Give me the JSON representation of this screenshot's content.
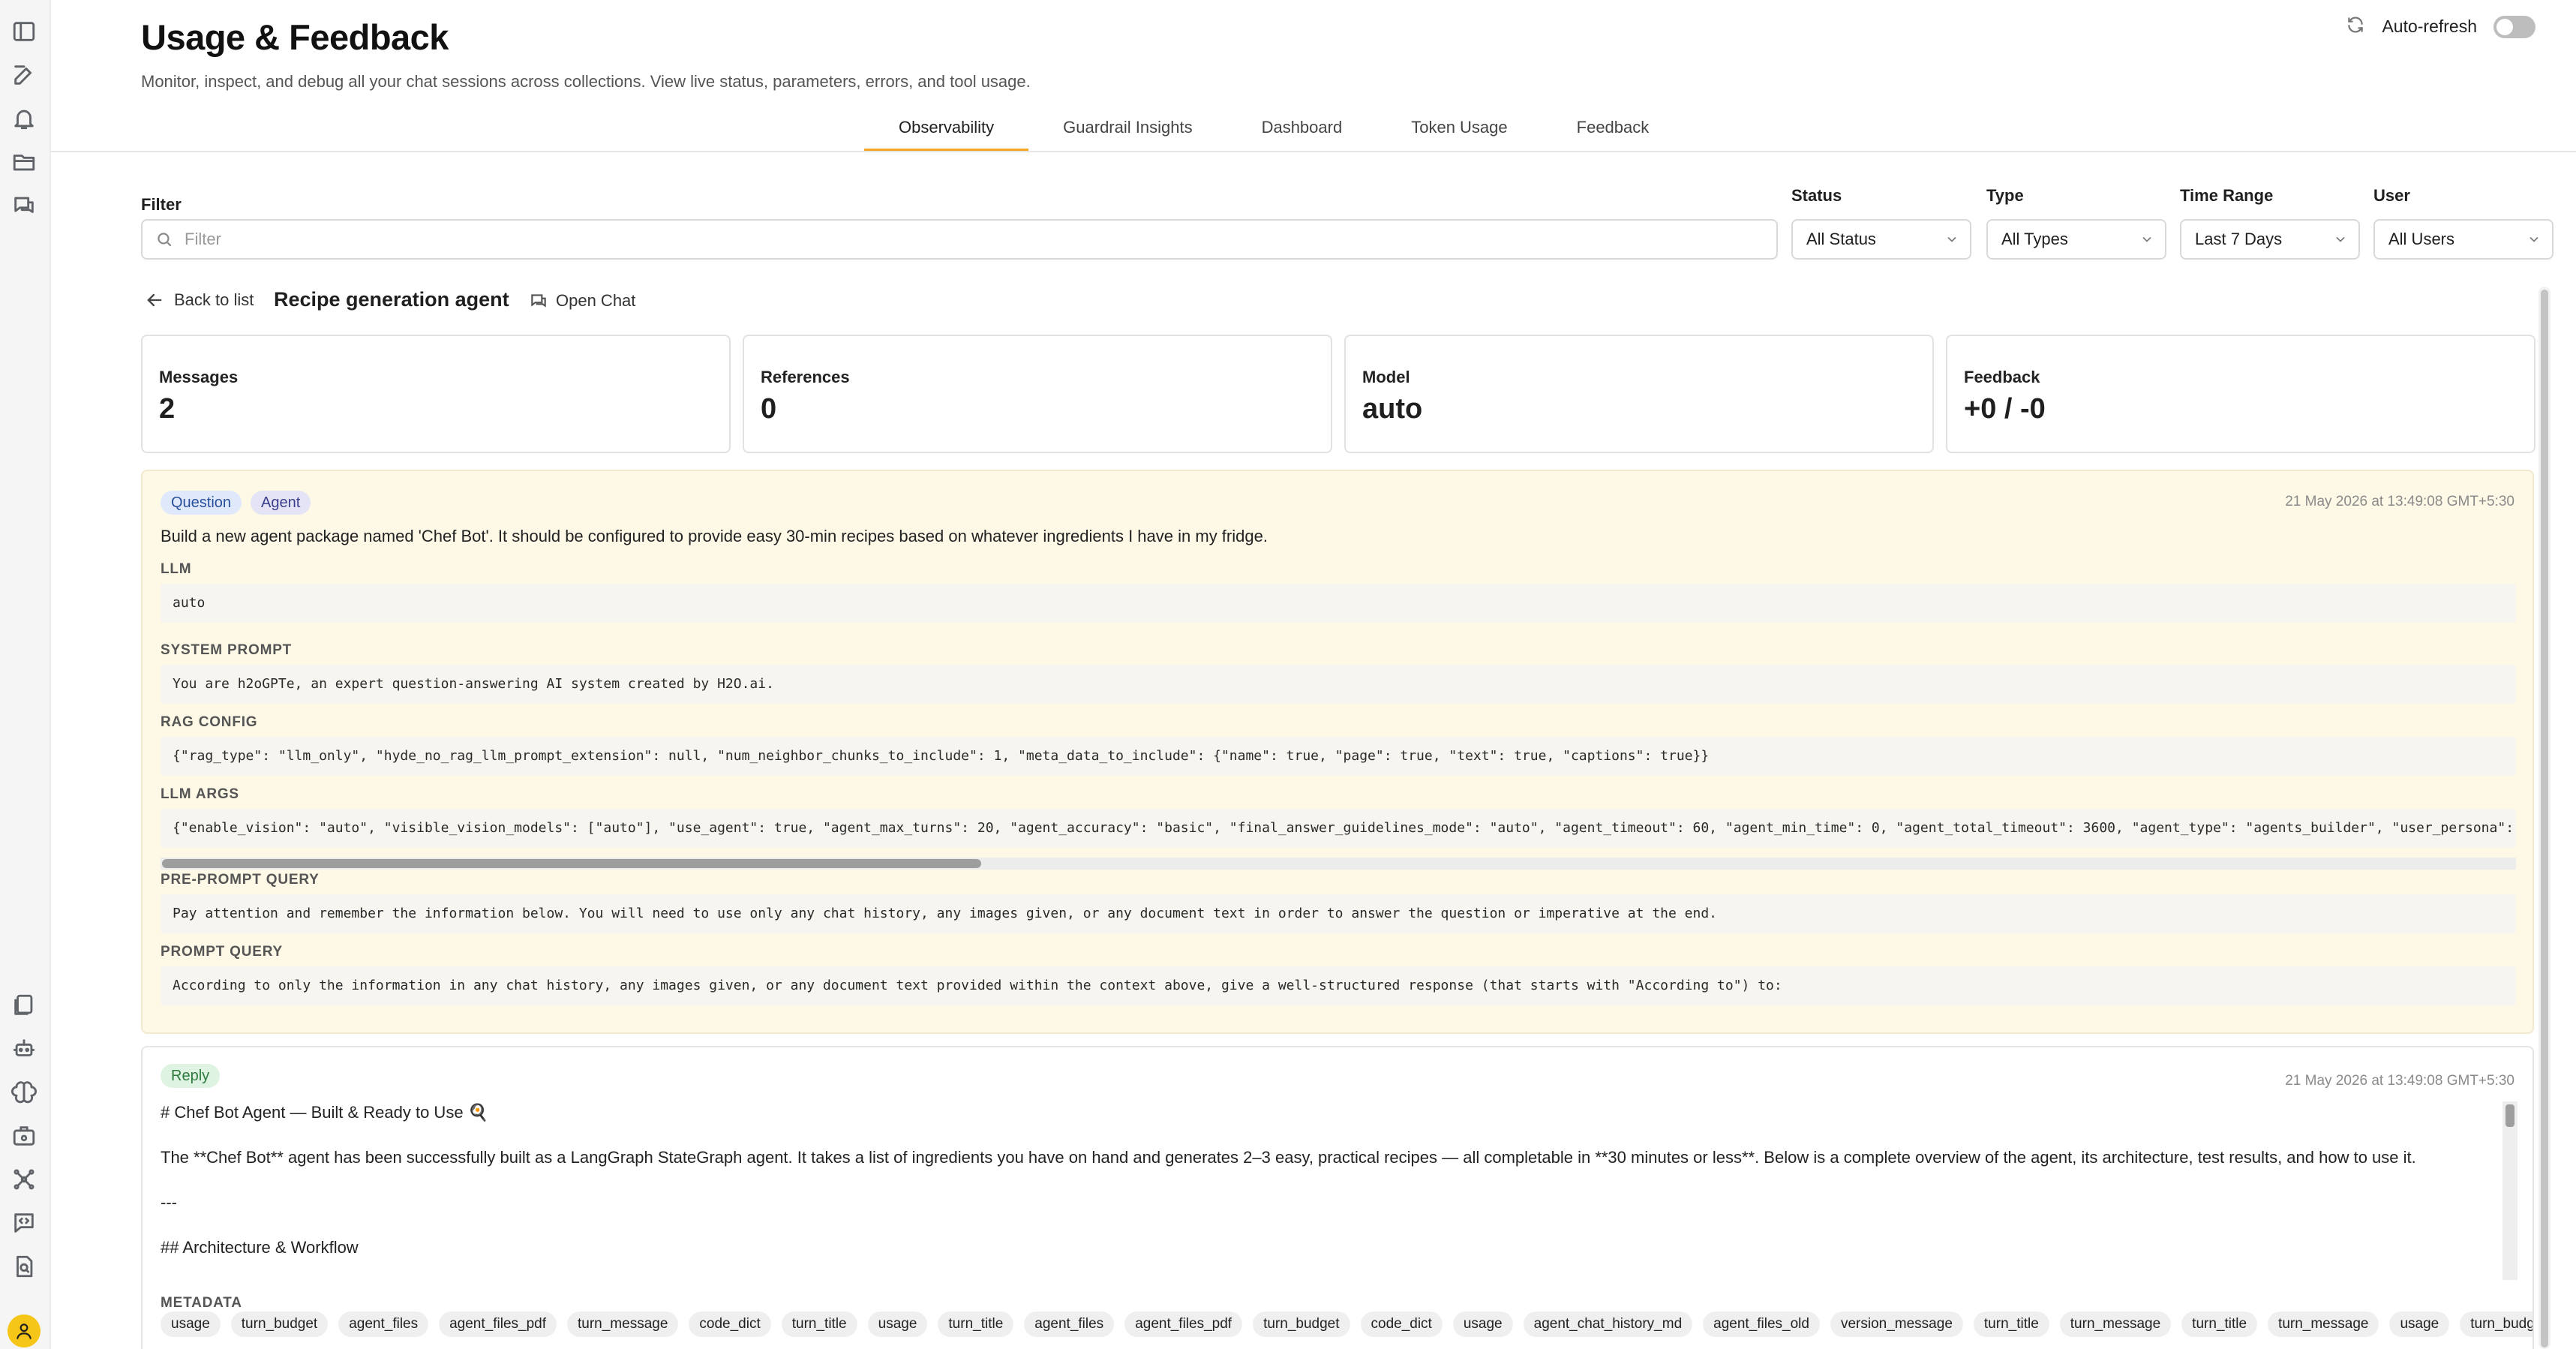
{
  "page": {
    "title": "Usage & Feedback",
    "subtitle": "Monitor, inspect, and debug all your chat sessions across collections. View live status, parameters, errors, and tool usage."
  },
  "autorefresh": {
    "label": "Auto-refresh",
    "enabled": false
  },
  "tabs": [
    {
      "label": "Observability",
      "active": true
    },
    {
      "label": "Guardrail Insights",
      "active": false
    },
    {
      "label": "Dashboard",
      "active": false
    },
    {
      "label": "Token Usage",
      "active": false
    },
    {
      "label": "Feedback",
      "active": false
    }
  ],
  "filters": {
    "filter_label": "Filter",
    "filter_placeholder": "Filter",
    "status": {
      "label": "Status",
      "value": "All Status"
    },
    "type": {
      "label": "Type",
      "value": "All Types"
    },
    "time_range": {
      "label": "Time Range",
      "value": "Last 7 Days"
    },
    "user": {
      "label": "User",
      "value": "All Users"
    }
  },
  "detail": {
    "back_label": "Back to list",
    "agent_name": "Recipe generation agent",
    "open_chat_label": "Open Chat"
  },
  "stats": [
    {
      "label": "Messages",
      "value": "2"
    },
    {
      "label": "References",
      "value": "0"
    },
    {
      "label": "Model",
      "value": "auto"
    },
    {
      "label": "Feedback",
      "value": "+0 / -0"
    }
  ],
  "question": {
    "badges": [
      "Question",
      "Agent"
    ],
    "timestamp": "21 May 2026 at 13:49:08 GMT+5:30",
    "text": "Build a new agent package named 'Chef Bot'. It should be configured to provide easy 30-min recipes based on whatever ingredients I have in my fridge.",
    "sections": {
      "llm": {
        "label": "LLM",
        "value": "auto"
      },
      "system_prompt": {
        "label": "SYSTEM PROMPT",
        "value": "You are h2oGPTe, an expert question-answering AI system created by H2O.ai."
      },
      "rag_config": {
        "label": "RAG CONFIG",
        "value": "{\"rag_type\": \"llm_only\", \"hyde_no_rag_llm_prompt_extension\": null, \"num_neighbor_chunks_to_include\": 1, \"meta_data_to_include\": {\"name\": true, \"page\": true, \"text\": true, \"captions\": true}}"
      },
      "llm_args": {
        "label": "LLM ARGS",
        "value": "{\"enable_vision\": \"auto\", \"visible_vision_models\": [\"auto\"], \"use_agent\": true, \"agent_max_turns\": 20, \"agent_accuracy\": \"basic\", \"final_answer_guidelines_mode\": \"auto\", \"agent_timeout\": 60, \"agent_min_time\": 0, \"agent_total_timeout\": 3600, \"agent_type\": \"agents_builder\", \"user_persona\":"
      },
      "pre_prompt_query": {
        "label": "PRE-PROMPT QUERY",
        "value": "Pay attention and remember the information below. You will need to use only any chat history, any images given, or any document text in order to answer the question or imperative at the end."
      },
      "prompt_query": {
        "label": "PROMPT QUERY",
        "value": "According to only the information in any chat history, any images given, or any document text provided within the context above, give a well-structured response (that starts with \"According to\") to:"
      }
    }
  },
  "reply": {
    "badge": "Reply",
    "timestamp": "21 May 2026 at 13:49:08 GMT+5:30",
    "lines": [
      "# Chef Bot Agent — Built & Ready to Use 🍳",
      "The **Chef Bot** agent has been successfully built as a LangGraph StateGraph agent. It takes a list of ingredients you have on hand and generates 2–3 easy, practical recipes — all completable in **30 minutes or less**. Below is a complete overview of the agent, its architecture, test results, and how to use it.",
      "---",
      "## Architecture & Workflow"
    ],
    "metadata_label": "METADATA",
    "metadata": [
      "usage",
      "turn_budget",
      "agent_files",
      "agent_files_pdf",
      "turn_message",
      "code_dict",
      "turn_title",
      "usage",
      "turn_title",
      "agent_files",
      "agent_files_pdf",
      "turn_budget",
      "code_dict",
      "usage",
      "agent_chat_history_md",
      "agent_files_old",
      "version_message",
      "turn_title",
      "turn_message",
      "turn_title",
      "turn_message",
      "usage",
      "turn_budget"
    ]
  },
  "colors": {
    "accent": "#f5a623",
    "question_bg": "#fdf9e6",
    "avatar": "#f5c518"
  },
  "icons": {
    "rail_top": [
      "sidebar-toggle-icon",
      "edit-icon",
      "bell-icon",
      "folder-icon",
      "chat-icon"
    ],
    "rail_bottom": [
      "documents-icon",
      "robot-icon",
      "brain-icon",
      "briefcase-icon",
      "network-icon",
      "code-chat-icon",
      "search-document-icon"
    ]
  }
}
